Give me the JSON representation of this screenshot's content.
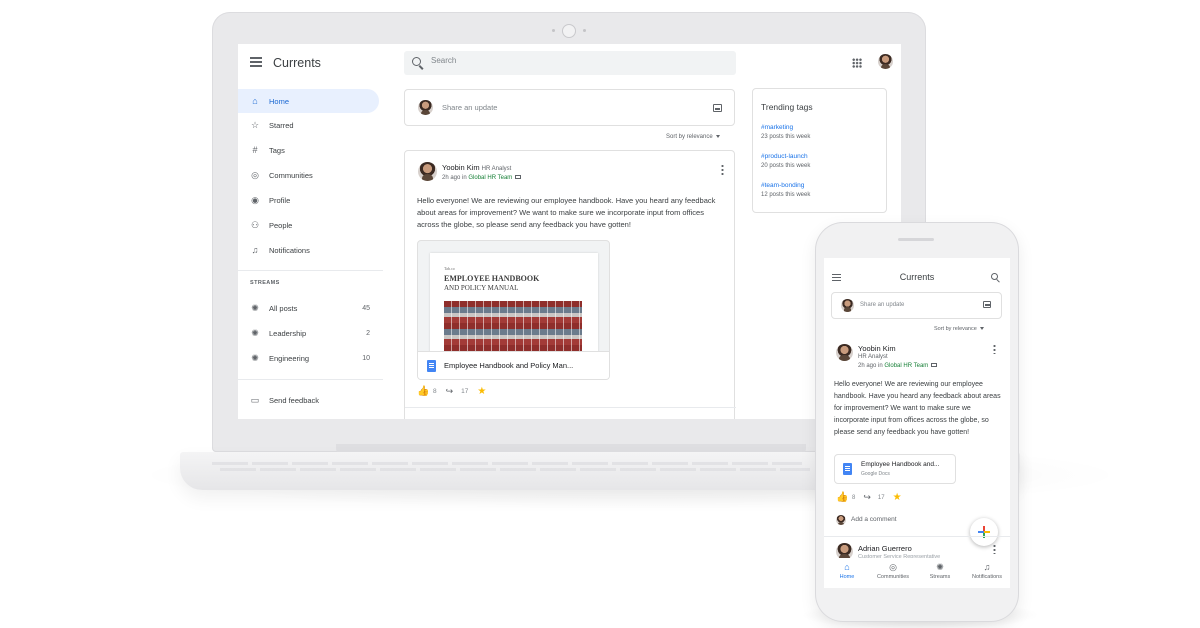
{
  "desktop": {
    "app_title": "Currents",
    "search": {
      "placeholder": "Search"
    },
    "sidebar": {
      "nav": [
        {
          "label": "Home",
          "icon": "home-icon",
          "active": true
        },
        {
          "label": "Starred",
          "icon": "star-icon"
        },
        {
          "label": "Tags",
          "icon": "hashtag-icon"
        },
        {
          "label": "Communities",
          "icon": "communities-icon"
        },
        {
          "label": "Profile",
          "icon": "profile-icon"
        },
        {
          "label": "People",
          "icon": "people-icon"
        },
        {
          "label": "Notifications",
          "icon": "bell-icon"
        }
      ],
      "streams_heading": "STREAMS",
      "streams": [
        {
          "label": "All posts",
          "count": "45",
          "icon": "stream-icon"
        },
        {
          "label": "Leadership",
          "count": "2",
          "icon": "stream-icon"
        },
        {
          "label": "Engineering",
          "count": "10",
          "icon": "stream-icon"
        }
      ],
      "send_feedback": "Send feedback"
    },
    "share_placeholder": "Share an update",
    "sort_label": "Sort by relevance",
    "post": {
      "author": "Yoobin Kim",
      "role": "HR Analyst",
      "time": "2h ago in",
      "community": "Global HR Team",
      "body": "Hello everyone! We are reviewing our employee handbook. Have you heard any feedback about areas for improvement? We want to make sure we incorporate input from offices across the globe, so please send any feedback you have gotten!",
      "attachment": {
        "doc_small": "Tab.co",
        "doc_title_line1": "EMPLOYEE HANDBOOK",
        "doc_title_line2": "AND POLICY MANUAL",
        "name": "Employee Handbook and Policy Man..."
      },
      "likes": "8",
      "shares": "17"
    },
    "trending": {
      "title": "Trending tags",
      "tags": [
        {
          "tag": "#marketing",
          "count": "23 posts this week"
        },
        {
          "tag": "#product-launch",
          "count": "20 posts this week"
        },
        {
          "tag": "#team-bonding",
          "count": "12 posts this week"
        }
      ]
    }
  },
  "mobile": {
    "app_title": "Currents",
    "share_placeholder": "Share an update",
    "sort_label": "Sort by relevance",
    "post": {
      "author": "Yoobin Kim",
      "role": "HR Analyst",
      "time": "2h ago in",
      "community": "Global HR Team",
      "body": "Hello everyone! We are reviewing our employee handbook. Have you heard any feedback about areas for improvement? We want to make sure we incorporate input from offices across the globe, so please send any feedback you have gotten!",
      "attachment_name": "Employee Handbook and...",
      "attachment_sub": "Google Docs",
      "likes": "8",
      "shares": "17",
      "add_comment": "Add a comment"
    },
    "next_post": {
      "author": "Adrian Guerrero",
      "role": "Customer Service Representative"
    },
    "bottom_nav": [
      {
        "label": "Home",
        "icon": "home-icon",
        "active": true
      },
      {
        "label": "Communities",
        "icon": "communities-icon"
      },
      {
        "label": "Streams",
        "icon": "stream-icon"
      },
      {
        "label": "Notifications",
        "icon": "bell-icon"
      }
    ]
  },
  "colors": {
    "accent": "#1a73e8",
    "active_bg": "#e8f0fe",
    "community_green": "#188038",
    "star": "#fbbc04"
  }
}
